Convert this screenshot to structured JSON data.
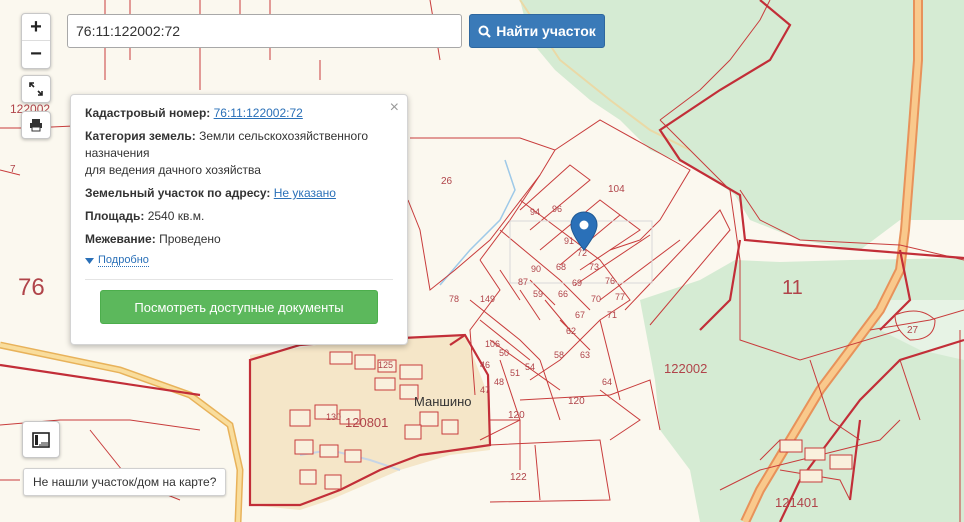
{
  "search": {
    "value": "76:11:122002:72",
    "button_label": "Найти участок",
    "button_icon": "search-icon"
  },
  "map_controls": {
    "zoom_in": "+",
    "zoom_out": "−",
    "fullscreen_icon": "fullscreen-icon",
    "print_icon": "printer-icon",
    "layers_icon": "layers-icon"
  },
  "popup": {
    "close": "×",
    "cadastral_label": "Кадастровый номер:",
    "cadastral_value": "76:11:122002:72",
    "category_label": "Категория земель:",
    "category_value_1": "Земли сельскохозяйственного",
    "category_value_2": "назначения",
    "category_value_3": "для ведения дачного хозяйства",
    "address_label": "Земельный участок по адресу:",
    "address_value": "Не указано",
    "area_label": "Площадь:",
    "area_value": "2540 кв.м.",
    "survey_label": "Межевание:",
    "survey_value": "Проведено",
    "details_label": "Подробно",
    "docs_button": "Посмотреть доступные документы"
  },
  "not_found_label": "Не нашли участок/дом на карте?",
  "map": {
    "labels": {
      "region_76": "76",
      "district_11": "11",
      "block_122002_left": "122002",
      "block_122002_right": "122002",
      "block_120801": "120801",
      "block_121401": "121401",
      "village": "Маншино",
      "p26": "26",
      "p104": "104",
      "p27": "27",
      "p120a": "120",
      "p120b": "120",
      "p122": "122",
      "p7": "7",
      "p96": "96",
      "p94": "94",
      "p91": "91",
      "p72": "72",
      "p90": "90",
      "p68": "68",
      "p73": "73",
      "p87": "87",
      "p59": "59",
      "p66": "66",
      "p69": "69",
      "p76": "76",
      "p77": "77",
      "p78": "78",
      "p149": "149",
      "p70": "70",
      "p71": "71",
      "p67": "67",
      "p62": "62",
      "p106": "106",
      "p50": "50",
      "p58": "58",
      "p63": "63",
      "p46": "46",
      "p48": "48",
      "p51": "51",
      "p54": "54",
      "p47": "47",
      "p64": "64",
      "p130": "130",
      "p125": "125"
    },
    "colors": {
      "background": "#fbf8ef",
      "forest": "#d5ebd3",
      "parcel_line": "#c83c3c",
      "road": "#f6ce7a",
      "water": "#9ec9e8",
      "marker": "#2a70b8"
    }
  }
}
